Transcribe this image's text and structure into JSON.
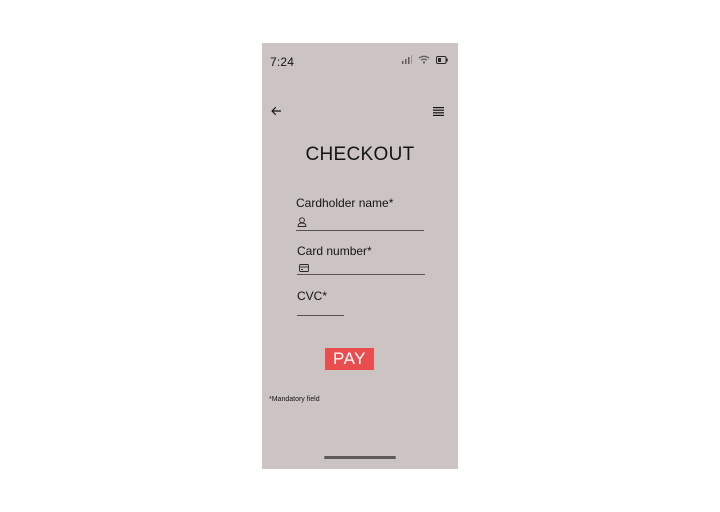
{
  "status_bar": {
    "time": "7:24",
    "icons": [
      "signal-icon",
      "wifi-icon",
      "battery-icon"
    ]
  },
  "header": {
    "back_icon": "arrow-left-icon",
    "menu_icon": "hamburger-menu-icon",
    "title": "CHECKOUT"
  },
  "form": {
    "cardholder_name": {
      "label": "Cardholder name*",
      "value": "",
      "icon": "person-icon"
    },
    "card_number": {
      "label": "Card number*",
      "value": "",
      "icon": "credit-card-icon"
    },
    "cvc": {
      "label": "CVC*",
      "value": ""
    }
  },
  "pay_button": {
    "label": "PAY"
  },
  "footnote": "*Mandatory field",
  "colors": {
    "screen_background": "#cbc4c2",
    "pay_button": "#e94d4d",
    "text": "#141414"
  }
}
